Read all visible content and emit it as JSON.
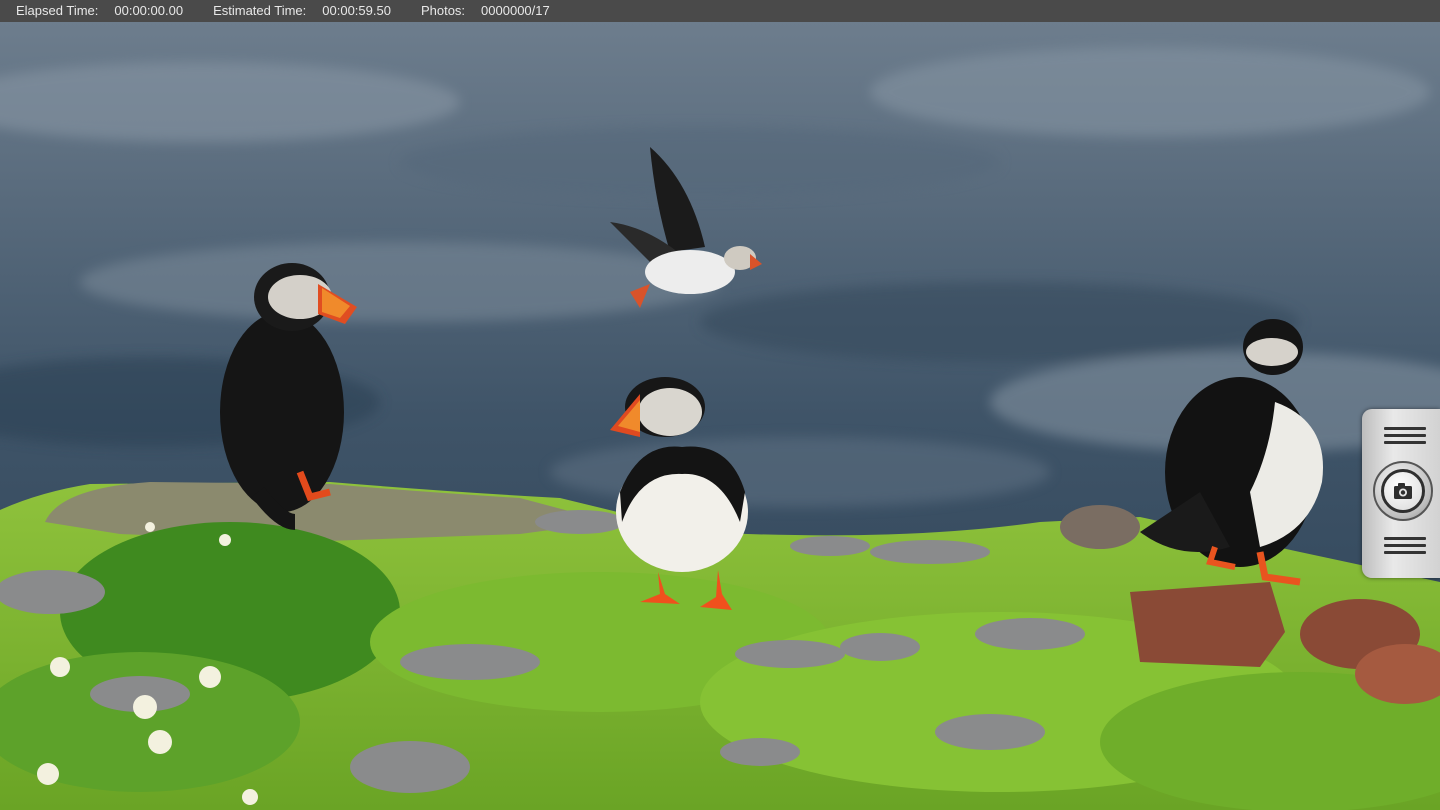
{
  "status_bar": {
    "elapsed_label": "Elapsed Time:",
    "elapsed_value": "00:00:00.00",
    "estimated_label": "Estimated Time:",
    "estimated_value": "00:00:59.50",
    "photos_label": "Photos:",
    "photos_value": "0000000/17"
  },
  "side_controls": {
    "top_icon": "menu-lines-icon",
    "shutter_icon": "camera-shutter-icon",
    "bottom_icon": "menu-lines-icon"
  },
  "colors": {
    "status_bar_bg": "#4a4a4a",
    "status_text": "#e8e8e8",
    "panel_bg": "#d9d9d9"
  }
}
